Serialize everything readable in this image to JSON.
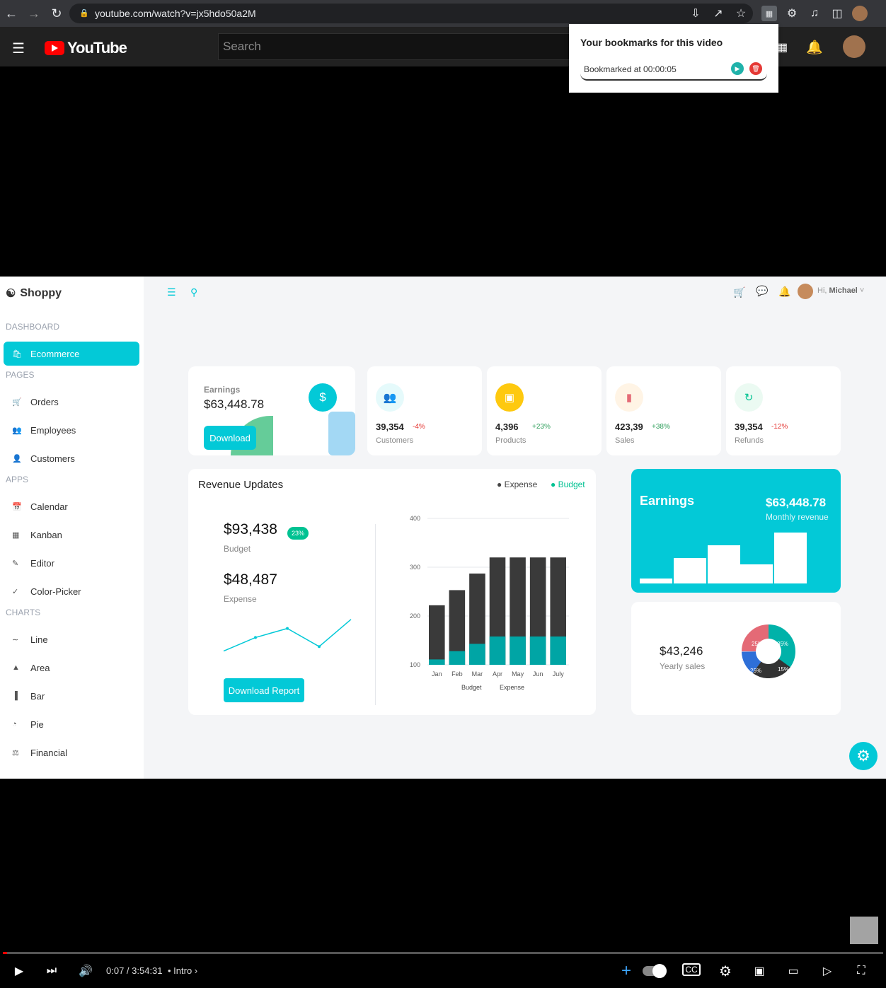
{
  "browser": {
    "url": "youtube.com/watch?v=jx5hdo50a2M"
  },
  "youtube": {
    "logo_text": "YouTube",
    "search_placeholder": "Search"
  },
  "popup": {
    "title": "Your bookmarks for this video",
    "bookmark": "Bookmarked at 00:00:05"
  },
  "app": {
    "brand": "Shoppy",
    "greeting_hi": "Hi,",
    "user": "Michael",
    "sidebar": {
      "sections": [
        {
          "title": "DASHBOARD",
          "items": [
            "Ecommerce"
          ]
        },
        {
          "title": "PAGES",
          "items": [
            "Orders",
            "Employees",
            "Customers"
          ]
        },
        {
          "title": "APPS",
          "items": [
            "Calendar",
            "Kanban",
            "Editor",
            "Color-Picker"
          ]
        },
        {
          "title": "CHARTS",
          "items": [
            "Line",
            "Area",
            "Bar",
            "Pie",
            "Financial"
          ]
        }
      ]
    },
    "earnings_card": {
      "label": "Earnings",
      "value": "$63,448.78",
      "button": "Download"
    },
    "stats": [
      {
        "value": "39,354",
        "change": "-4%",
        "label": "Customers",
        "color": "#03c9d7",
        "bg": "#e5fafb",
        "neg": true
      },
      {
        "value": "4,396",
        "change": "+23%",
        "label": "Products",
        "color": "#fff",
        "bg": "#fec90f",
        "neg": false
      },
      {
        "value": "423,39",
        "change": "+38%",
        "label": "Sales",
        "color": "#e46a76",
        "bg": "#fff4e5",
        "neg": false
      },
      {
        "value": "39,354",
        "change": "-12%",
        "label": "Refunds",
        "color": "#00c292",
        "bg": "#ebfaf2",
        "neg": true
      }
    ],
    "revenue": {
      "title": "Revenue Updates",
      "legend_expense": "Expense",
      "legend_budget": "Budget",
      "budget_value": "$93,438",
      "budget_badge": "23%",
      "budget_label": "Budget",
      "expense_value": "$48,487",
      "expense_label": "Expense",
      "button": "Download Report"
    },
    "earnings_big": {
      "title": "Earnings",
      "value": "$63,448.78",
      "sub": "Monthly revenue"
    },
    "yearly": {
      "value": "$43,246",
      "label": "Yearly sales",
      "slices": [
        "25%",
        "35%",
        "15%",
        "25%"
      ]
    }
  },
  "chart_data": [
    {
      "type": "bar",
      "categories": [
        "Jan",
        "Feb",
        "Mar",
        "Apr",
        "May",
        "Jun",
        "July"
      ],
      "series": [
        {
          "name": "Budget",
          "values": [
            111,
            128,
            143,
            158,
            158,
            158,
            158
          ]
        },
        {
          "name": "Expense",
          "values": [
            222,
            253,
            287,
            320,
            320,
            320,
            320
          ]
        }
      ],
      "yticks": [
        "100",
        "200",
        "300",
        "400"
      ],
      "ylim": [
        100,
        400
      ],
      "legend": [
        "Budget",
        "Expense"
      ]
    },
    {
      "type": "line",
      "values": [
        10,
        40,
        60,
        20,
        80
      ]
    }
  ],
  "player": {
    "time": "0:07 / 3:54:31",
    "chapter": "Intro"
  }
}
